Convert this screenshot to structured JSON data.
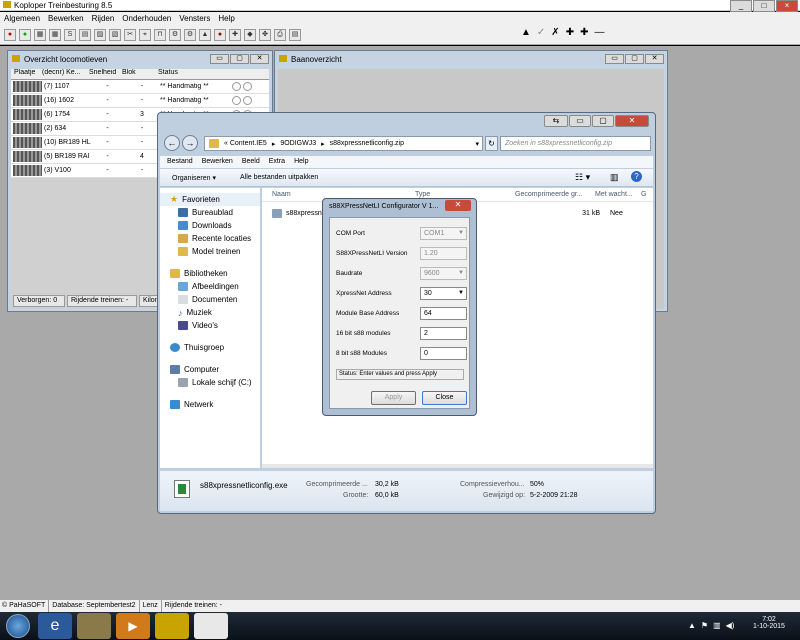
{
  "app": {
    "title": "Koploper Treinbesturing 8.5",
    "menu": [
      "Algemeen",
      "Bewerken",
      "Rijden",
      "Onderhouden",
      "Vensters",
      "Help"
    ],
    "right_tools": [
      "▲",
      "✓",
      "✗",
      "✚",
      "✚",
      "—"
    ]
  },
  "loco_window": {
    "title": "Overzicht locomotieven",
    "columns": [
      "Plaatje",
      "(decnr) Ke...",
      "Snelheid",
      "Blok",
      "Status"
    ],
    "rows": [
      {
        "name": "(7) 1107",
        "speed": "-",
        "block": "-",
        "status": "** Handmatig **"
      },
      {
        "name": "(16) 1602",
        "speed": "-",
        "block": "-",
        "status": "** Handmatig **"
      },
      {
        "name": "(6) 1754",
        "speed": "-",
        "block": "3",
        "status": "** Handmatig **"
      },
      {
        "name": "(2) 634",
        "speed": "-",
        "block": "-",
        "status": ""
      },
      {
        "name": "(10) BR189 HL",
        "speed": "-",
        "block": "-",
        "status": ""
      },
      {
        "name": "(5) BR189 RAI",
        "speed": "-",
        "block": "4",
        "status": ""
      },
      {
        "name": "(3) V100",
        "speed": "-",
        "block": "-",
        "status": ""
      }
    ],
    "status": [
      "Verborgen: 0",
      "Rijdende treinen: -",
      "Kilomet"
    ]
  },
  "baan_window": {
    "title": "Baanoverzicht"
  },
  "explorer": {
    "path": [
      "«  Content.IE5",
      "9ODIGWJ3",
      "s88xpressnetliconfig.zip"
    ],
    "search_placeholder": "Zoeken in s88xpressnetliconfig.zip",
    "menu": [
      "Bestand",
      "Bewerken",
      "Beeld",
      "Extra",
      "Help"
    ],
    "organize": "Organiseren ▾",
    "extract": "Alle bestanden uitpakken",
    "nav": {
      "favorites": "Favorieten",
      "fav_items": [
        "Bureaublad",
        "Downloads",
        "Recente locaties",
        "Model treinen"
      ],
      "libraries": "Bibliotheken",
      "lib_items": [
        "Afbeeldingen",
        "Documenten",
        "Muziek",
        "Video's"
      ],
      "homegroup": "Thuisgroep",
      "computer": "Computer",
      "drive": "Lokale schijf (C:)",
      "network": "Netwerk"
    },
    "columns": [
      "Naam",
      "Type",
      "Gecomprimeerde gr...",
      "Met wacht...",
      "G"
    ],
    "file": {
      "name": "s88xpressn",
      "size": "31 kB",
      "pw": "Nee"
    },
    "details": {
      "filename": "s88xpressnetliconfig.exe",
      "k1": "Gecomprimeerde ...",
      "v1": "30,2 kB",
      "k2": "Grootte:",
      "v2": "60,0 kB",
      "k3": "Compressieverhou...",
      "v3": "50%",
      "k4": "Gewijzigd op:",
      "v4": "5-2-2009 21:28"
    }
  },
  "dialog": {
    "title": "s88XPressNetLI Configurator V 1...",
    "fields": [
      {
        "label": "COM Port",
        "value": "COM1",
        "disabled": true,
        "select": true
      },
      {
        "label": "S88XPressNetLI Version",
        "value": "1.20",
        "disabled": true,
        "select": false
      },
      {
        "label": "Baudrate",
        "value": "9600",
        "disabled": true,
        "select": true
      },
      {
        "label": "XpressNet Address",
        "value": "30",
        "disabled": false,
        "select": true
      },
      {
        "label": "Module Base Address",
        "value": "64",
        "disabled": false,
        "select": false
      },
      {
        "label": "16 bit s88 modules",
        "value": "2",
        "disabled": false,
        "select": false
      },
      {
        "label": "8 bit s88 Modules",
        "value": "0",
        "disabled": false,
        "select": false
      }
    ],
    "status": "Status: Enter values and press Apply",
    "apply": "Apply",
    "close": "Close"
  },
  "bottom_status": [
    "© PaHaSOFT",
    "Database: Septembertest2",
    "Lenz",
    "Rijdende treinen: -"
  ],
  "taskbar": {
    "time": "7:02",
    "date": "1-10-2015"
  }
}
